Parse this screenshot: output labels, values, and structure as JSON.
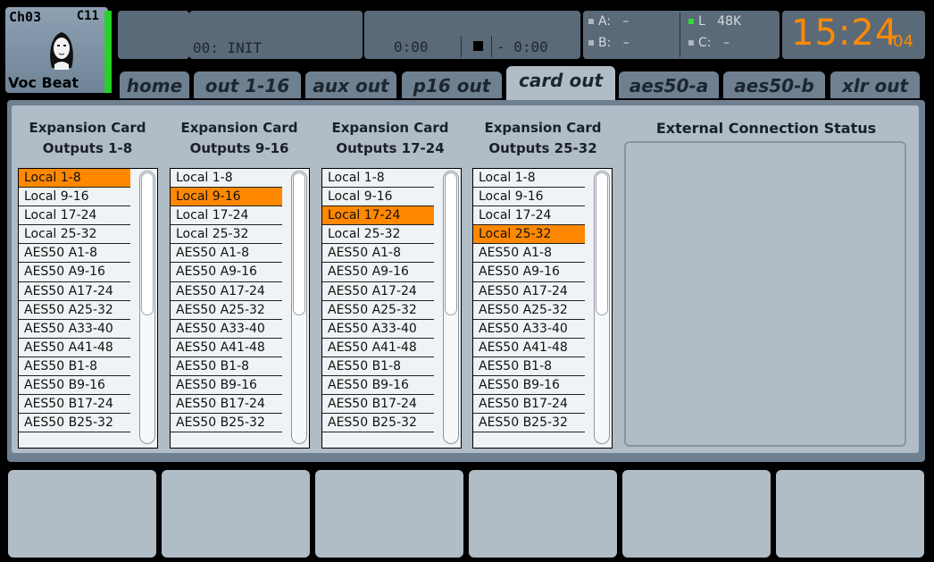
{
  "header": {
    "channel_id": "Ch03",
    "channel_code": "C11",
    "channel_name": "Voc Beat",
    "scene": "00: INIT",
    "time_elapsed": "0:00",
    "time_remaining": "- 0:00",
    "status": {
      "a_label": "A:",
      "a_value": "–",
      "b_label": "B:",
      "b_value": "–",
      "l_label": "L",
      "l_value": "48K",
      "c_label": "C:",
      "c_value": "–"
    },
    "clock_main": "15:24",
    "clock_seconds": "04"
  },
  "tabs": [
    "home",
    "out 1-16",
    "aux out",
    "p16 out",
    "card out",
    "aes50-a",
    "aes50-b",
    "xlr out"
  ],
  "active_tab": "card out",
  "columns": [
    {
      "title_line1": "Expansion Card",
      "title_line2": "Outputs 1-8",
      "selected": 0
    },
    {
      "title_line1": "Expansion Card",
      "title_line2": "Outputs 9-16",
      "selected": 1
    },
    {
      "title_line1": "Expansion Card",
      "title_line2": "Outputs 17-24",
      "selected": 2
    },
    {
      "title_line1": "Expansion Card",
      "title_line2": "Outputs 25-32",
      "selected": 3
    }
  ],
  "options": [
    "Local 1-8",
    "Local 9-16",
    "Local 17-24",
    "Local 25-32",
    "AES50 A1-8",
    "AES50 A9-16",
    "AES50 A17-24",
    "AES50 A25-32",
    "AES50 A33-40",
    "AES50 A41-48",
    "AES50 B1-8",
    "AES50 B9-16",
    "AES50 B17-24",
    "AES50 B25-32"
  ],
  "external_status_title": "External Connection Status",
  "colors": {
    "accent": "#ff8800",
    "clock": "#ff8a00",
    "active_led": "#2ee02e"
  }
}
